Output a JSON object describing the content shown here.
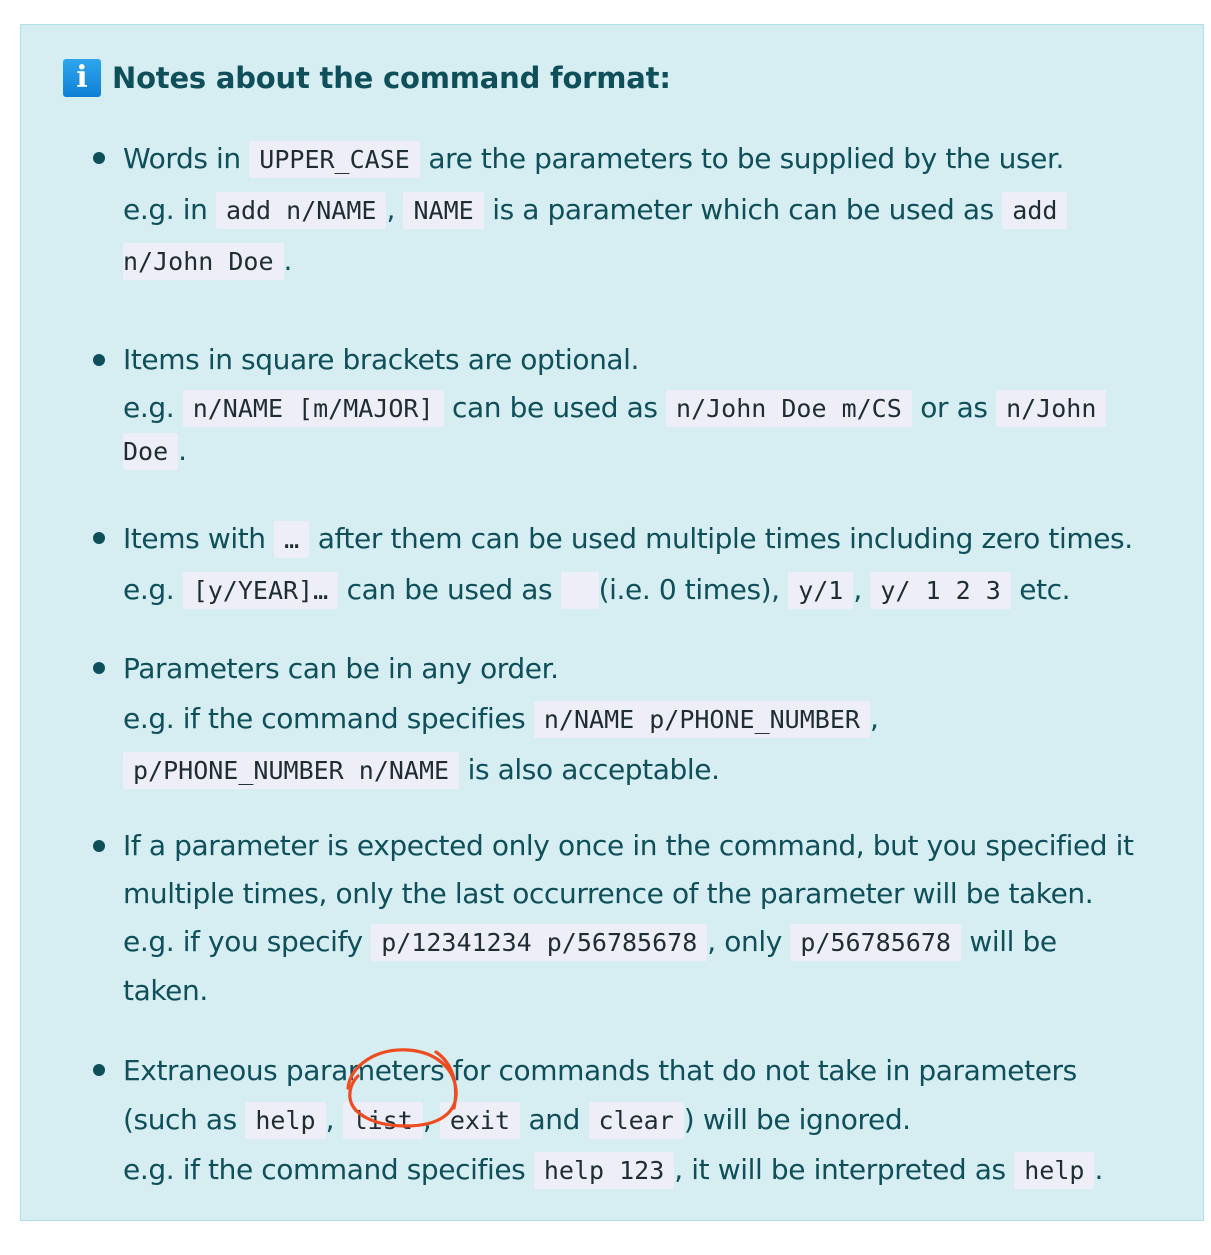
{
  "callout": {
    "icon": "info-icon",
    "icon_glyph": "i",
    "title": "Notes about the command format:",
    "colors": {
      "background": "#d6edf2",
      "border": "#aee0e6",
      "text": "#0f4f5a",
      "code_background": "#eeeef9",
      "icon": "#1a8fe0",
      "annotation": "#ee4b1f"
    }
  },
  "notes": [
    {
      "l1": {
        "t1": "Words in ",
        "c1": "UPPER_CASE",
        "t2": " are the parameters to be supplied by the user."
      },
      "l2": {
        "t1": "e.g. in ",
        "c1": "add n/NAME",
        "t2": ", ",
        "c2": "NAME",
        "t3": " is a parameter which can be used as ",
        "c3": "add"
      },
      "l3": {
        "c1": "n/John Doe",
        "t1": "."
      }
    },
    {
      "l1": {
        "t1": "Items in square brackets are optional."
      },
      "l2": {
        "t1": "e.g. ",
        "c1": "n/NAME [m/MAJOR]",
        "t2": " can be used as ",
        "c2": "n/John Doe m/CS",
        "t3": " or as ",
        "c3": "n/John"
      },
      "l3": {
        "c1": "Doe",
        "t1": "."
      }
    },
    {
      "l1": {
        "t1": "Items with ",
        "c1": "…",
        "t2": " after them can be used multiple times including zero times."
      },
      "l2": {
        "t1": "e.g. ",
        "c1": "[y/YEAR]…",
        "t2": " can be used as ",
        "c2": "",
        "t3": " (i.e. 0 times), ",
        "c3": "y/1",
        "t4": ", ",
        "c4": "y/ 1 2 3",
        "t5": " etc."
      }
    },
    {
      "l1": {
        "t1": "Parameters can be in any order."
      },
      "l2": {
        "t1": "e.g. if the command specifies ",
        "c1": "n/NAME p/PHONE_NUMBER",
        "t2": ","
      },
      "l3": {
        "c1": "p/PHONE_NUMBER n/NAME",
        "t1": " is also acceptable."
      }
    },
    {
      "l1": {
        "t1": "If a parameter is expected only once in the command, but you specified it"
      },
      "l2": {
        "t1": "multiple times, only the last occurrence of the parameter will be taken."
      },
      "l3": {
        "t1": "e.g. if you specify ",
        "c1": "p/12341234 p/56785678",
        "t2": ", only ",
        "c2": "p/56785678",
        "t3": " will be"
      },
      "l4": {
        "t1": "taken."
      }
    },
    {
      "l1": {
        "t1": "Extraneous parameters for commands that do not take in parameters"
      },
      "l2": {
        "t1": "(such as ",
        "c1": "help",
        "t2": ", ",
        "c2": "list",
        "t3": ", ",
        "c3": "exit",
        "t4": " and ",
        "c4": "clear",
        "t5": ") will be ignored."
      },
      "l3": {
        "t1": "e.g. if the command specifies ",
        "c1": "help 123",
        "t2": ", it will be interpreted as ",
        "c2": "help",
        "t3": "."
      }
    }
  ],
  "annotation": {
    "shape": "hand-drawn-circle",
    "target": "list"
  }
}
